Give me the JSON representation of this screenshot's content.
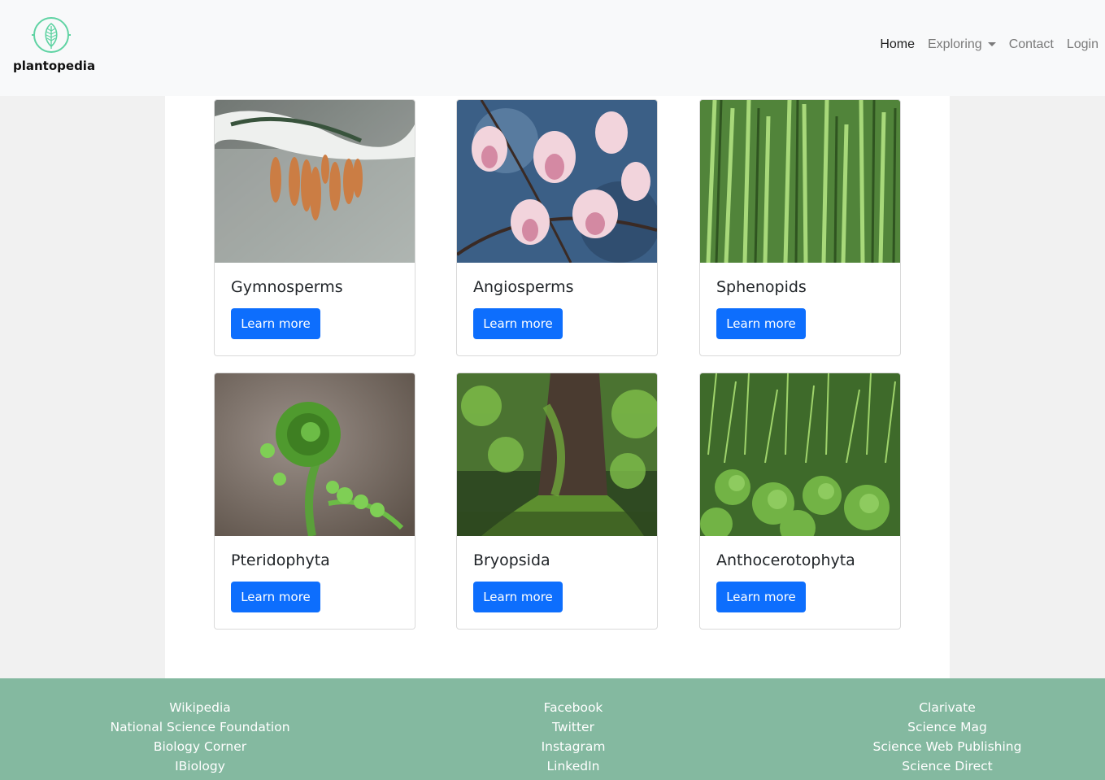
{
  "brand": {
    "name": "plantopedia",
    "accent": "#5fd3a3"
  },
  "nav": {
    "home": "Home",
    "exploring": "Exploring",
    "contact": "Contact",
    "login": "Login"
  },
  "cards": [
    {
      "title": "Gymnosperms",
      "button": "Learn more"
    },
    {
      "title": "Angiosperms",
      "button": "Learn more"
    },
    {
      "title": "Sphenopids",
      "button": "Learn more"
    },
    {
      "title": "Pteridophyta",
      "button": "Learn more"
    },
    {
      "title": "Bryopsida",
      "button": "Learn more"
    },
    {
      "title": "Anthocerotophyta",
      "button": "Learn more"
    }
  ],
  "footer": {
    "col1": [
      "Wikipedia",
      "National Science Foundation",
      "Biology Corner",
      "IBiology"
    ],
    "col2": [
      "Facebook",
      "Twitter",
      "Instagram",
      "LinkedIn"
    ],
    "col3": [
      "Clarivate",
      "Science Mag",
      "Science Web Publishing",
      "Science Direct"
    ]
  },
  "colors": {
    "button": "#0d6efd",
    "footer": "#84b9a0",
    "navbar": "#f8f9fa"
  }
}
